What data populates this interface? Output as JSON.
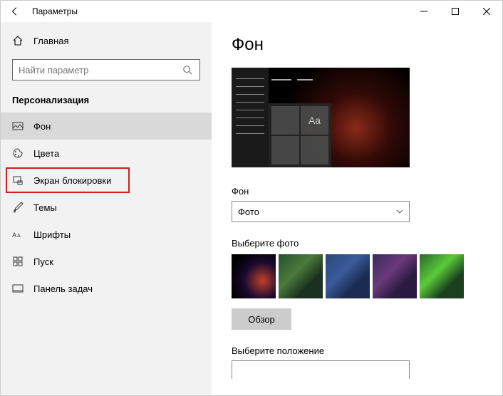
{
  "window": {
    "title": "Параметры"
  },
  "sidebar": {
    "home": "Главная",
    "search_placeholder": "Найти параметр",
    "section": "Персонализация",
    "items": [
      {
        "label": "Фон"
      },
      {
        "label": "Цвета"
      },
      {
        "label": "Экран блокировки"
      },
      {
        "label": "Темы"
      },
      {
        "label": "Шрифты"
      },
      {
        "label": "Пуск"
      },
      {
        "label": "Панель задач"
      }
    ]
  },
  "content": {
    "heading": "Фон",
    "preview_sample": "Aa",
    "bg_label": "Фон",
    "bg_value": "Фото",
    "choose_photo": "Выберите фото",
    "browse": "Обзор",
    "position_label": "Выберите положение"
  }
}
